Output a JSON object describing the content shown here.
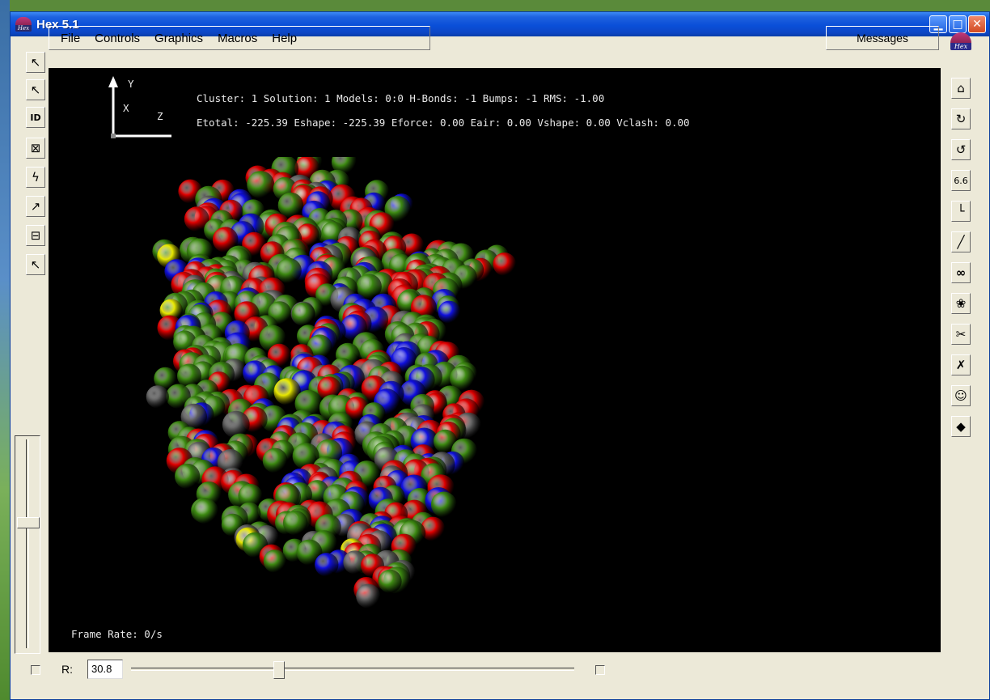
{
  "window": {
    "title": "Hex 5.1",
    "logo_text": "Hex"
  },
  "menu": [
    "File",
    "Controls",
    "Graphics",
    "Macros",
    "Help"
  ],
  "messages_label": "Messages",
  "left_tools": [
    "arrow-cursor",
    "small-arrow-cursor",
    "ID",
    "crossed-box",
    "lightning",
    "sparkle-arrow",
    "box-shapes",
    "hammer"
  ],
  "left_tool_labels": {
    "id": "ID"
  },
  "right_tools": [
    "home",
    "rotate-a",
    "rotate-b",
    "6.6",
    "axis-corner",
    "diagonal-line",
    "binoculars",
    "blob",
    "tool-a",
    "tool-b",
    "person",
    "diamond-arrow"
  ],
  "right_tool_labels": {
    "scale": "6.6"
  },
  "axes": {
    "y": "Y",
    "x": "X",
    "z": "Z"
  },
  "info": {
    "line1": "Cluster: 1 Solution: 1 Models: 0:0 H-Bonds: -1 Bumps: -1 RMS: -1.00",
    "line2": "Etotal: -225.39 Eshape: -225.39 Eforce: 0.00 Eair: 0.00 Vshape: 0.00 Vclash: 0.00"
  },
  "frame_rate": "Frame Rate: 0/s",
  "r_label": "R:",
  "r_value": "30.8",
  "r_slider_fraction": 0.33,
  "colors": {
    "green": "#3d8a12",
    "red": "#e00000",
    "blue": "#1010e0",
    "gray": "#606060",
    "yellow": "#e8e800"
  }
}
